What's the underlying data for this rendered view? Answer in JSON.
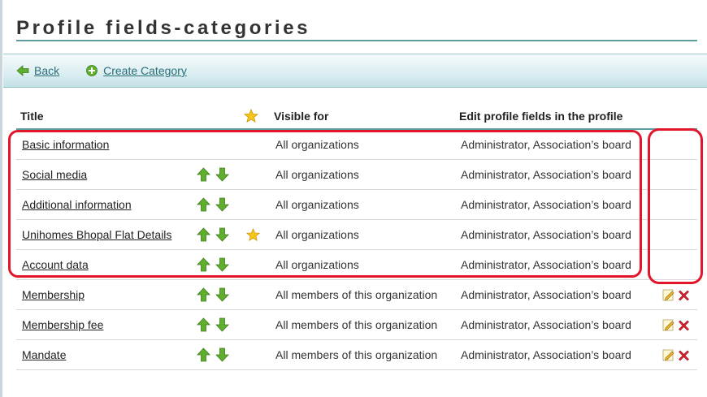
{
  "page": {
    "title": "Profile fields-categories"
  },
  "toolbar": {
    "back_label": "Back",
    "create_label": "Create Category"
  },
  "table": {
    "headers": {
      "title": "Title",
      "visible_for": "Visible for",
      "edit_fields": "Edit profile fields in the profile"
    },
    "rows": [
      {
        "title": "Basic information",
        "visible_for": "All organizations",
        "edit_fields": "Administrator, Association’s board",
        "arrows": false,
        "star": false,
        "actions": false
      },
      {
        "title": "Social media",
        "visible_for": "All organizations",
        "edit_fields": "Administrator, Association’s board",
        "arrows": true,
        "star": false,
        "actions": false
      },
      {
        "title": "Additional information",
        "visible_for": "All organizations",
        "edit_fields": "Administrator, Association’s board",
        "arrows": true,
        "star": false,
        "actions": false
      },
      {
        "title": "Unihomes Bhopal Flat Details",
        "visible_for": "All organizations",
        "edit_fields": "Administrator, Association’s board",
        "arrows": true,
        "star": true,
        "actions": false
      },
      {
        "title": "Account data",
        "visible_for": "All organizations",
        "edit_fields": "Administrator, Association’s board",
        "arrows": true,
        "star": false,
        "actions": false
      },
      {
        "title": "Membership",
        "visible_for": "All members of this organization",
        "edit_fields": "Administrator, Association’s board",
        "arrows": true,
        "star": false,
        "actions": true
      },
      {
        "title": "Membership fee",
        "visible_for": "All members of this organization",
        "edit_fields": "Administrator, Association’s board",
        "arrows": true,
        "star": false,
        "actions": true
      },
      {
        "title": "Mandate",
        "visible_for": "All members of this organization",
        "edit_fields": "Administrator, Association’s board",
        "arrows": true,
        "star": false,
        "actions": true
      }
    ]
  },
  "colors": {
    "accent": "#5f9ea0",
    "link": "#2a6e7a",
    "highlight": "#e2152b",
    "arrow_green": "#5fae2e",
    "star": "#f5c518",
    "delete_red": "#d9232e"
  },
  "icons": {
    "back": "back-arrow-icon",
    "create": "plus-circle-icon",
    "up": "arrow-up-icon",
    "down": "arrow-down-icon",
    "star": "star-icon",
    "edit": "pencil-icon",
    "delete": "delete-x-icon"
  }
}
